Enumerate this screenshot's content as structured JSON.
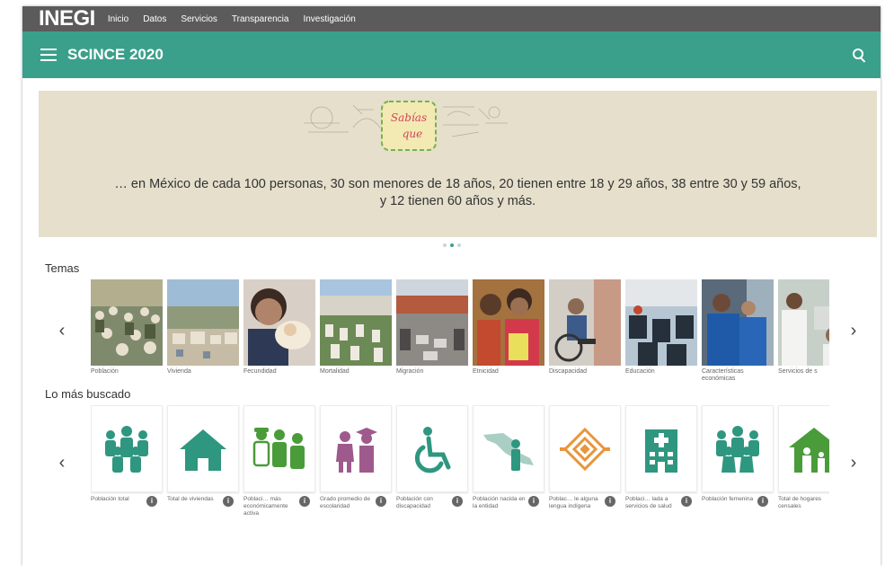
{
  "topbar": {
    "logo": "INEGI",
    "nav": [
      "Inicio",
      "Datos",
      "Servicios",
      "Transparencia",
      "Investigación"
    ]
  },
  "appbar": {
    "title": "SCINCE 2020"
  },
  "banner": {
    "badge_line1": "Sabías",
    "badge_line2": "que",
    "text_line1": "… en México de cada 100 personas, 30 son menores de 18 años, 20 tienen entre 18 y 29 años, 38 entre 30 y 59 años,",
    "text_line2": "y 12 tienen 60 años y más.",
    "active_slide": 2,
    "slides": 3
  },
  "temas": {
    "title": "Temas",
    "prev": "‹",
    "next": "›",
    "items": [
      {
        "label": "Población",
        "img": "crowd-photo"
      },
      {
        "label": "Vivienda",
        "img": "houses-photo"
      },
      {
        "label": "Fecundidad",
        "img": "baby-photo"
      },
      {
        "label": "Mortalidad",
        "img": "cemetery-photo"
      },
      {
        "label": "Migración",
        "img": "border-photo"
      },
      {
        "label": "Etnicidad",
        "img": "indigenous-women-photo"
      },
      {
        "label": "Discapacidad",
        "img": "wheelchair-photo"
      },
      {
        "label": "Educación",
        "img": "classroom-photo"
      },
      {
        "label": "Características económicas",
        "img": "workers-photo"
      },
      {
        "label": "Servicios de s",
        "img": "doctor-photo"
      }
    ]
  },
  "buscado": {
    "title": "Lo más buscado",
    "prev": "‹",
    "next": "›",
    "accent": "#2f9680",
    "secondary": "#9e5a8c",
    "orange": "#e8953b",
    "green": "#4a9b3a",
    "items": [
      {
        "label": "Población total",
        "icon": "population-icon"
      },
      {
        "label": "Total de viviendas",
        "icon": "house-icon"
      },
      {
        "label": "Poblaci… más económicamente activa",
        "icon": "workers-icon"
      },
      {
        "label": "Grado promedio de escolaridad",
        "icon": "graduates-icon"
      },
      {
        "label": "Población con discapacidad",
        "icon": "wheelchair-icon"
      },
      {
        "label": "Población nacida en la entidad",
        "icon": "map-person-icon"
      },
      {
        "label": "Poblac… le alguna lengua indígena",
        "icon": "indigenous-pattern-icon"
      },
      {
        "label": "Poblaci… lada a servicios de salud",
        "icon": "hospital-icon"
      },
      {
        "label": "Población femenina",
        "icon": "women-group-icon"
      },
      {
        "label": "Total de hogares censales",
        "icon": "household-icon"
      }
    ],
    "info_glyph": "i"
  }
}
